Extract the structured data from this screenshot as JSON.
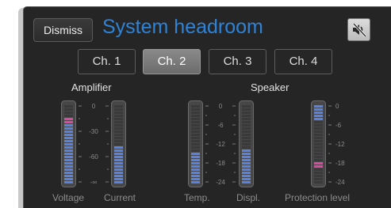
{
  "dialog": {
    "dismiss_label": "Dismiss",
    "title": "System headroom",
    "mute_icon": "speaker-muted-icon"
  },
  "channels": {
    "items": [
      "Ch. 1",
      "Ch. 2",
      "Ch. 3",
      "Ch. 4"
    ],
    "selected": "Ch. 2"
  },
  "sections": {
    "amplifier": "Amplifier",
    "speaker": "Speaker"
  },
  "amplifier_scale": [
    "0",
    "-30",
    "-60",
    "-∞"
  ],
  "speaker_scale": [
    "0",
    "-6",
    "-12",
    "-18",
    "-24"
  ],
  "protection_scale": [
    "0",
    "-6",
    "-12",
    "-18",
    "-24"
  ],
  "meters": {
    "voltage": {
      "label": "Voltage",
      "level_fraction": 0.78,
      "hold_fraction": 0.82
    },
    "current": {
      "label": "Current",
      "level_fraction": 0.48
    },
    "temperature": {
      "label": "Temp.",
      "level_fraction": 0.4
    },
    "displacement": {
      "label": "Displ.",
      "level_fraction": 0.43
    },
    "protection": {
      "label": "Protection level",
      "level_fraction": 0.8,
      "marker_fraction": 0.23
    }
  },
  "colors": {
    "title": "#2f83d6",
    "meter_fill": "#5a82e0",
    "meter_hold": "#d94aa0",
    "meter_off": "#3a3a3a",
    "meter_tick": "#7d7d7d"
  }
}
